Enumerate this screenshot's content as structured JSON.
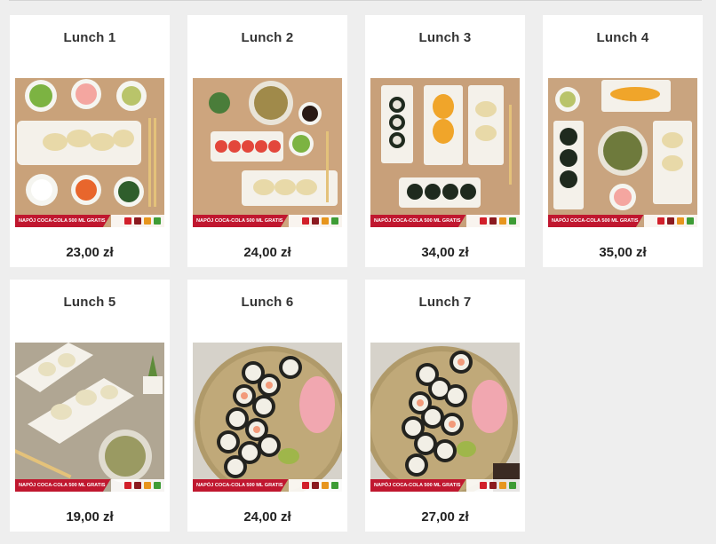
{
  "promo": {
    "text": "NAPÓJ COCA-COLA 500 ML GRATIS",
    "icons": [
      "chili-icon",
      "spicy-icon",
      "allergen-icon",
      "vegetarian-icon"
    ]
  },
  "products": [
    {
      "title": "Lunch 1",
      "price": "23,00 zł"
    },
    {
      "title": "Lunch 2",
      "price": "24,00 zł"
    },
    {
      "title": "Lunch 3",
      "price": "34,00 zł"
    },
    {
      "title": "Lunch 4",
      "price": "35,00 zł"
    },
    {
      "title": "Lunch 5",
      "price": "19,00 zł"
    },
    {
      "title": "Lunch 6",
      "price": "24,00 zł"
    },
    {
      "title": "Lunch 7",
      "price": "27,00 zł"
    }
  ]
}
